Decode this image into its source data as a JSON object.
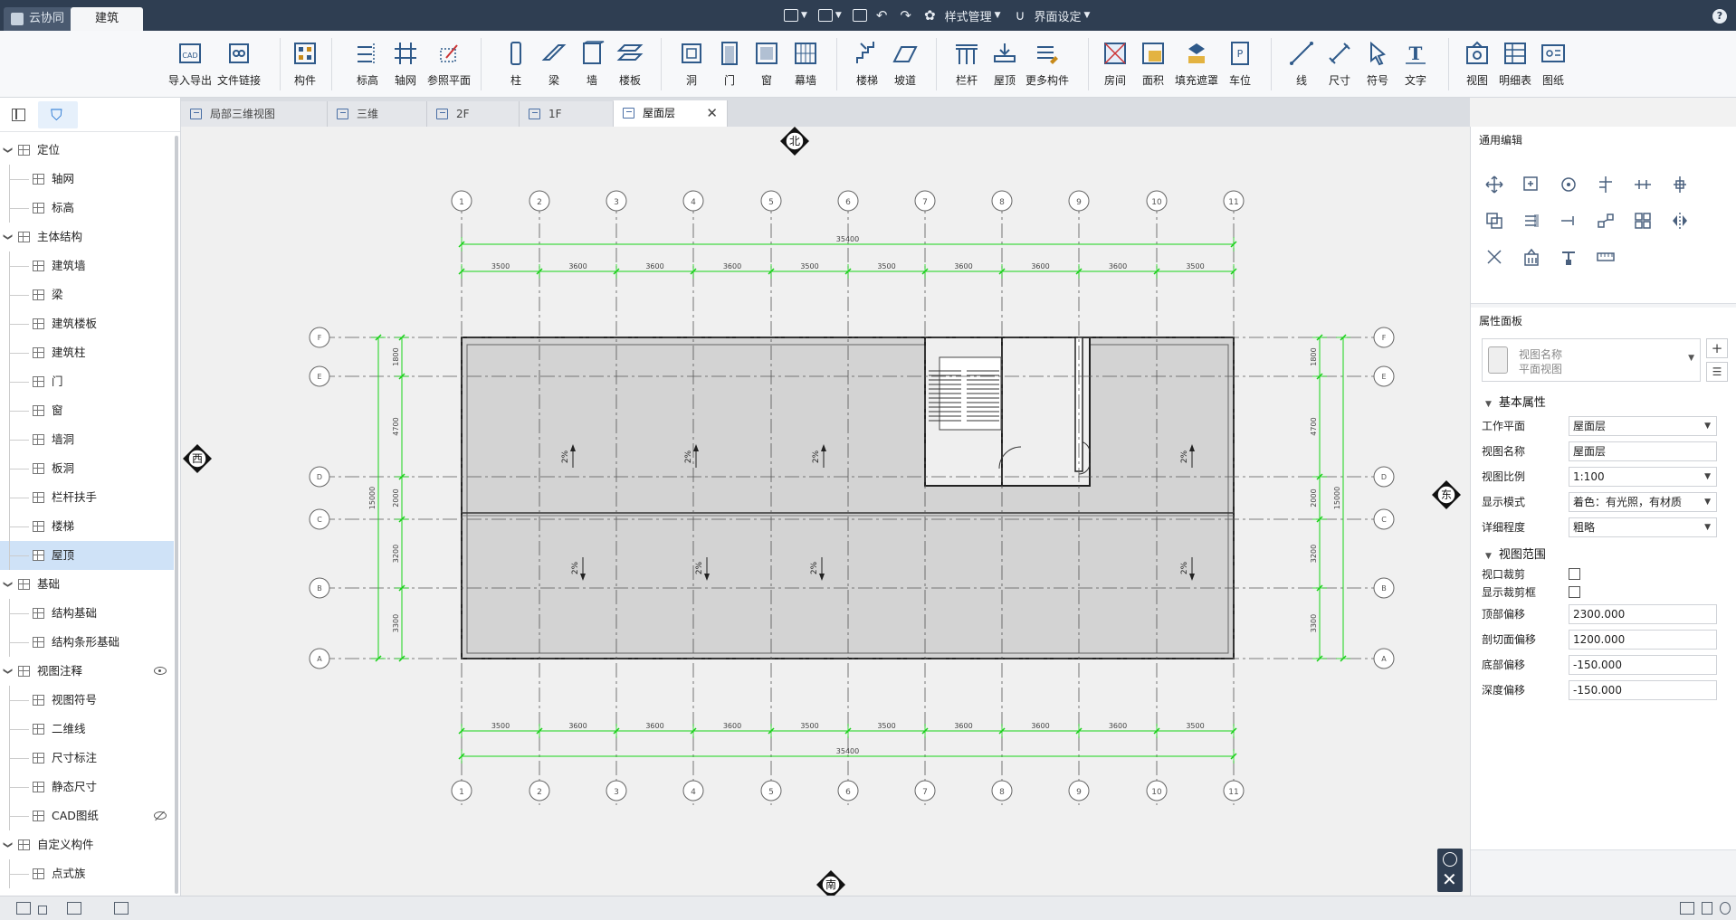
{
  "app": {
    "tabs": [
      {
        "label": "云协同",
        "icon": "cube-logo-icon"
      },
      {
        "label": "建筑",
        "active": true
      }
    ],
    "quick_menus": {
      "style": "样式管理",
      "ui": "界面设定"
    }
  },
  "ribbon": {
    "groups": [
      [
        {
          "label": "导入导出",
          "icon": "cad-import-icon"
        },
        {
          "label": "文件链接",
          "icon": "file-link-icon"
        }
      ],
      [
        {
          "label": "构件",
          "icon": "component-icon"
        }
      ],
      [
        {
          "label": "标高",
          "icon": "level-icon"
        },
        {
          "label": "轴网",
          "icon": "grid-axis-icon"
        },
        {
          "label": "参照平面",
          "icon": "reference-plane-icon"
        }
      ],
      [
        {
          "label": "柱",
          "icon": "column-icon"
        },
        {
          "label": "梁",
          "icon": "beam-icon"
        },
        {
          "label": "墙",
          "icon": "wall-icon"
        },
        {
          "label": "楼板",
          "icon": "floor-slab-icon"
        }
      ],
      [
        {
          "label": "洞",
          "icon": "opening-icon"
        },
        {
          "label": "门",
          "icon": "door-icon"
        },
        {
          "label": "窗",
          "icon": "window-icon"
        },
        {
          "label": "幕墙",
          "icon": "curtain-wall-icon"
        }
      ],
      [
        {
          "label": "楼梯",
          "icon": "stair-icon"
        },
        {
          "label": "坡道",
          "icon": "ramp-icon"
        }
      ],
      [
        {
          "label": "栏杆",
          "icon": "railing-icon"
        },
        {
          "label": "屋顶",
          "icon": "roof-icon"
        },
        {
          "label": "更多构件",
          "icon": "more-components-icon"
        }
      ],
      [
        {
          "label": "房间",
          "icon": "room-icon"
        },
        {
          "label": "面积",
          "icon": "area-icon"
        },
        {
          "label": "填充遮罩",
          "icon": "fill-mask-icon"
        },
        {
          "label": "车位",
          "icon": "parking-icon"
        }
      ],
      [
        {
          "label": "线",
          "icon": "line-icon"
        },
        {
          "label": "尺寸",
          "icon": "dimension-icon"
        },
        {
          "label": "符号",
          "icon": "symbol-icon"
        },
        {
          "label": "文字",
          "icon": "text-icon"
        }
      ],
      [
        {
          "label": "视图",
          "icon": "view-icon"
        },
        {
          "label": "明细表",
          "icon": "schedule-icon"
        },
        {
          "label": "图纸",
          "icon": "drawing-sheet-icon"
        }
      ]
    ]
  },
  "tree": [
    {
      "label": "定位",
      "type": "group",
      "children": [
        {
          "label": "轴网"
        },
        {
          "label": "标高"
        }
      ]
    },
    {
      "label": "主体结构",
      "type": "group",
      "children": [
        {
          "label": "建筑墙"
        },
        {
          "label": "梁"
        },
        {
          "label": "建筑楼板"
        },
        {
          "label": "建筑柱"
        },
        {
          "label": "门"
        },
        {
          "label": "窗"
        },
        {
          "label": "墙洞"
        },
        {
          "label": "板洞"
        },
        {
          "label": "栏杆扶手"
        },
        {
          "label": "楼梯"
        },
        {
          "label": "屋顶",
          "selected": true
        }
      ]
    },
    {
      "label": "基础",
      "type": "group",
      "children": [
        {
          "label": "结构基础"
        },
        {
          "label": "结构条形基础"
        }
      ]
    },
    {
      "label": "视图注释",
      "type": "group",
      "eye": "visible",
      "children": [
        {
          "label": "视图符号"
        },
        {
          "label": "二维线"
        },
        {
          "label": "尺寸标注"
        },
        {
          "label": "静态尺寸"
        },
        {
          "label": "CAD图纸",
          "eye": "hidden"
        }
      ]
    },
    {
      "label": "自定义构件",
      "type": "group",
      "children": [
        {
          "label": "点式族"
        }
      ]
    }
  ],
  "doc_tabs": [
    {
      "label": "局部三维视图"
    },
    {
      "label": "三维"
    },
    {
      "label": "2F"
    },
    {
      "label": "1F"
    },
    {
      "label": "屋面层",
      "active": true
    }
  ],
  "drawing": {
    "compass": {
      "north": "北",
      "south": "南",
      "west": "西",
      "east": "东"
    },
    "col_axes": [
      "1",
      "2",
      "3",
      "4",
      "5",
      "6",
      "7",
      "8",
      "9",
      "10",
      "11"
    ],
    "row_axes": [
      "F",
      "E",
      "D",
      "C",
      "B",
      "A"
    ],
    "total_width": "35400",
    "col_dims": [
      "3500",
      "3600",
      "3600",
      "3600",
      "3500",
      "3500",
      "3600",
      "3600",
      "3600",
      "3500"
    ],
    "total_depth": "15000",
    "row_dims": [
      "1800",
      "4700",
      "2000",
      "3200",
      "3300"
    ],
    "slopes": [
      "2%",
      "2%",
      "2%",
      "2%",
      "2%",
      "2%",
      "2%",
      "2%"
    ],
    "accent": "#19d319"
  },
  "right": {
    "edit_title": "通用编辑",
    "edit_tools": [
      "move-icon",
      "copy-icon",
      "rotate-icon",
      "trim-icon",
      "split-icon",
      "align-icon",
      "offset-icon",
      "array-icon",
      "extend-icon",
      "join-icon",
      "group-icon",
      "mirror-icon",
      "delete-icon",
      "pin-icon",
      "measure-tool-icon",
      "ruler-icon"
    ],
    "prop_title": "属性面板",
    "view_selector": {
      "name": "视图名称",
      "type": "平面视图"
    },
    "basic_title": "基本属性",
    "props": [
      {
        "label": "工作平面",
        "value": "屋面层",
        "dropdown": true
      },
      {
        "label": "视图名称",
        "value": "屋面层",
        "dropdown": false
      },
      {
        "label": "视图比例",
        "value": "1:100",
        "dropdown": true
      },
      {
        "label": "显示模式",
        "value": "着色：有光照，有材质",
        "dropdown": true
      },
      {
        "label": "详细程度",
        "value": "粗略",
        "dropdown": true
      }
    ],
    "range_title": "视图范围",
    "checks": [
      {
        "label": "视口裁剪",
        "checked": false
      },
      {
        "label": "显示裁剪框",
        "checked": false
      }
    ],
    "range_props": [
      {
        "label": "顶部偏移",
        "value": "2300.000"
      },
      {
        "label": "剖切面偏移",
        "value": "1200.000"
      },
      {
        "label": "底部偏移",
        "value": "-150.000"
      },
      {
        "label": "深度偏移",
        "value": "-150.000"
      }
    ]
  }
}
